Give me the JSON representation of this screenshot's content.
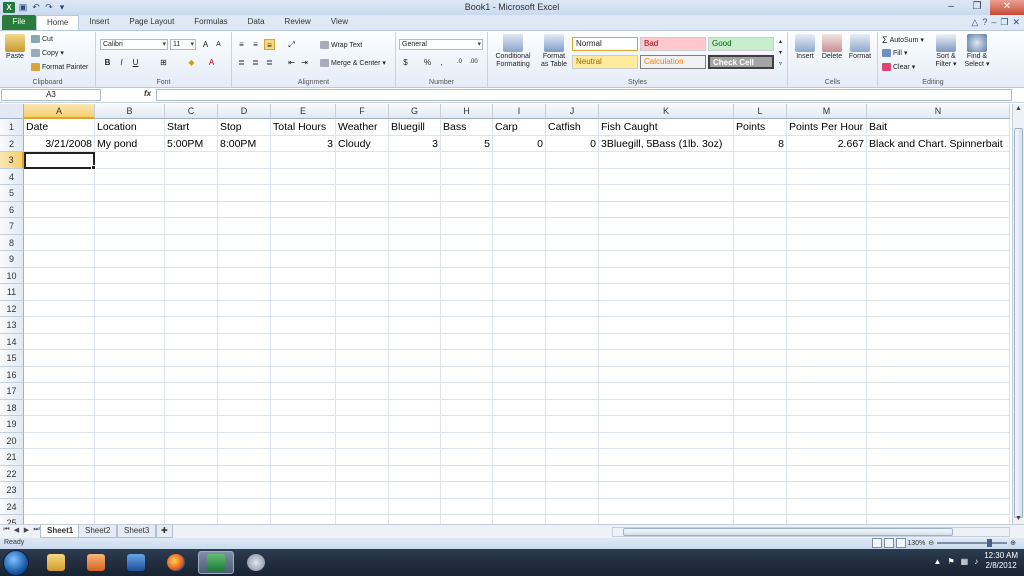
{
  "window": {
    "title": "Book1 - Microsoft Excel",
    "app_icon_letter": "X"
  },
  "tabs": [
    {
      "label": "File"
    },
    {
      "label": "Home"
    },
    {
      "label": "Insert"
    },
    {
      "label": "Page Layout"
    },
    {
      "label": "Formulas"
    },
    {
      "label": "Data"
    },
    {
      "label": "Review"
    },
    {
      "label": "View"
    }
  ],
  "ribbon": {
    "clipboard": {
      "label": "Clipboard",
      "paste": "Paste",
      "cut": "Cut",
      "copy": "Copy",
      "format_painter": "Format Painter"
    },
    "font": {
      "label": "Font",
      "name": "Calibri",
      "size": "11"
    },
    "alignment": {
      "label": "Alignment",
      "wrap_text": "Wrap Text",
      "merge_center": "Merge & Center"
    },
    "number": {
      "label": "Number",
      "format": "General"
    },
    "styles": {
      "label": "Styles",
      "conditional_formatting_1": "Conditional",
      "conditional_formatting_2": "Formatting",
      "format_as_table_1": "Format",
      "format_as_table_2": "as Table",
      "normal": "Normal",
      "bad": "Bad",
      "good": "Good",
      "neutral": "Neutral",
      "calculation": "Calculation",
      "check_cell": "Check Cell"
    },
    "cells": {
      "label": "Cells",
      "insert": "Insert",
      "delete": "Delete",
      "format": "Format"
    },
    "editing": {
      "label": "Editing",
      "autosum": "AutoSum",
      "fill": "Fill",
      "clear": "Clear",
      "sort_filter_1": "Sort &",
      "sort_filter_2": "Filter",
      "find_select_1": "Find &",
      "find_select_2": "Select"
    }
  },
  "formula_bar": {
    "name_box": "A3",
    "fx": "fx",
    "content": ""
  },
  "columns": [
    "A",
    "B",
    "C",
    "D",
    "E",
    "F",
    "G",
    "H",
    "I",
    "J",
    "K",
    "L",
    "M",
    "N"
  ],
  "rows": [
    "1",
    "2",
    "3",
    "4",
    "5",
    "6",
    "7",
    "8",
    "9",
    "10",
    "11",
    "12",
    "13",
    "14",
    "15",
    "16",
    "17",
    "18",
    "19",
    "20",
    "21",
    "22",
    "23",
    "24",
    "25"
  ],
  "sheet": {
    "header": [
      "Date",
      "Location",
      "Start",
      "Stop",
      "Total Hours",
      "Weather",
      "Bluegill",
      "Bass",
      "Carp",
      "Catfish",
      "Fish Caught",
      "Points",
      "Points Per Hour",
      "Bait"
    ],
    "row2": [
      "3/21/2008",
      "My pond",
      "5:00PM",
      "8:00PM",
      "3",
      "Cloudy",
      "3",
      "5",
      "0",
      "0",
      "3Bluegill, 5Bass (1lb. 3oz)",
      "8",
      "2.667",
      "Black and Chart. Spinnerbait"
    ]
  },
  "sheet_tabs": [
    {
      "label": "Sheet1"
    },
    {
      "label": "Sheet2"
    },
    {
      "label": "Sheet3"
    }
  ],
  "status": {
    "ready": "Ready",
    "zoom": "130%"
  },
  "taskbar": {
    "time": "12:30 AM",
    "date": "2/8/2012"
  }
}
